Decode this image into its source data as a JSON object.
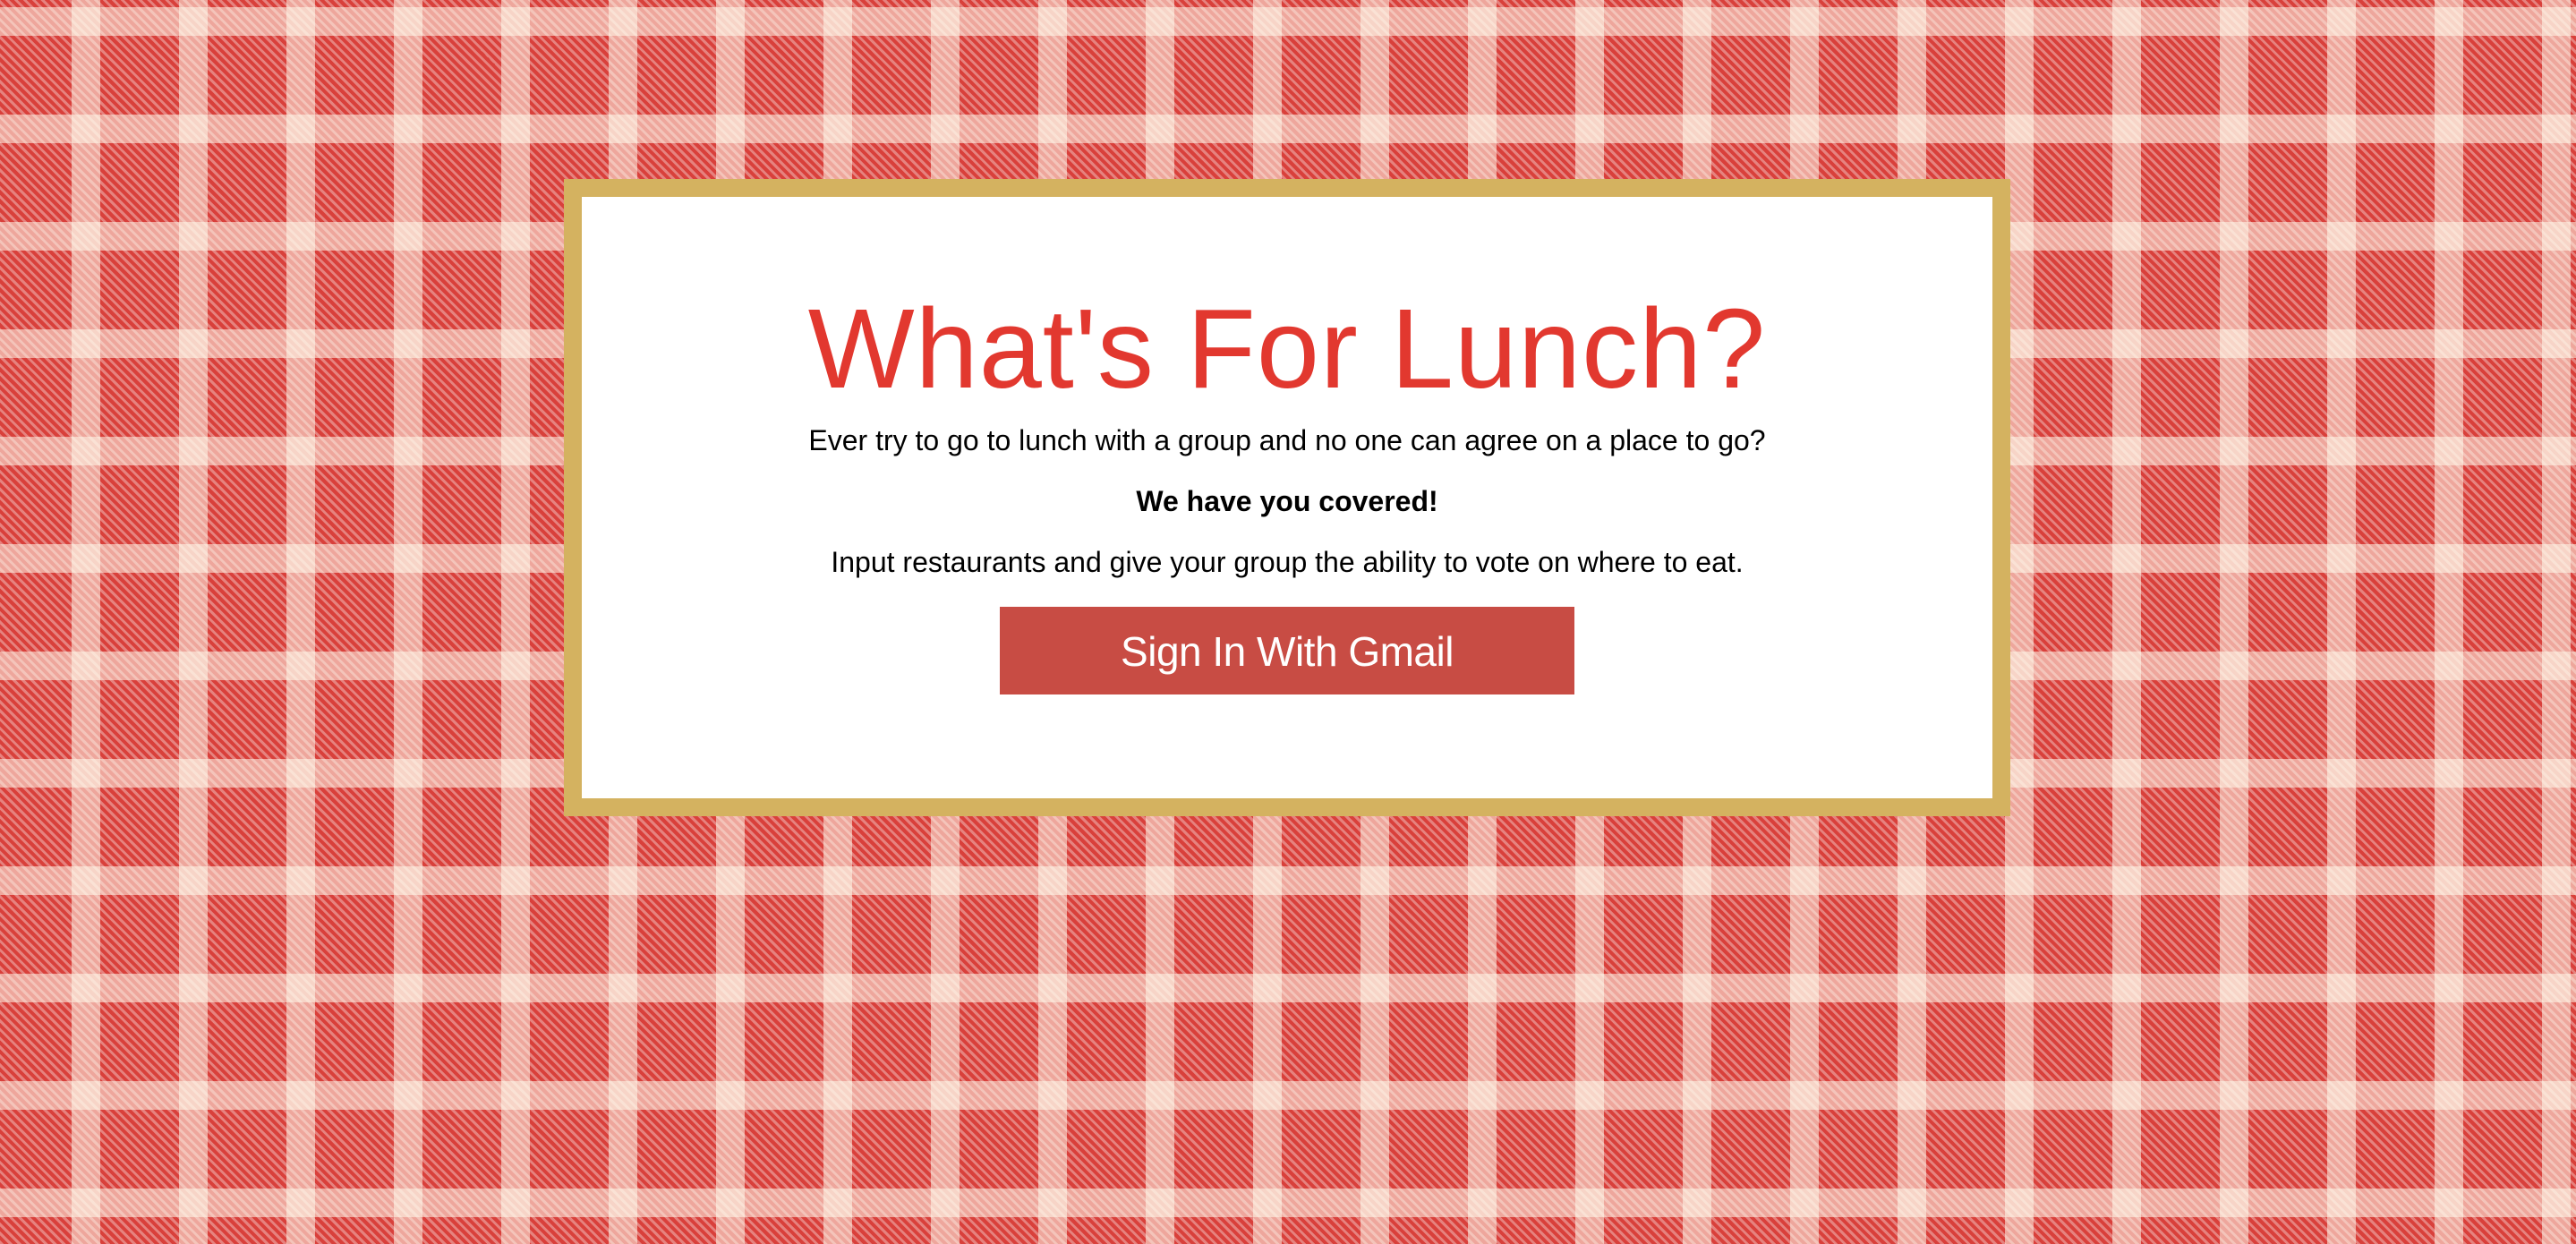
{
  "page": {
    "background_colors": {
      "red": "#d9403b",
      "cream": "#fffaeb"
    }
  },
  "card": {
    "frame_color": "#d4b260",
    "title": "What's For Lunch?",
    "title_color": "#e2382f",
    "intro": "Ever try to go to lunch with a group and no one can agree on a place to go?",
    "tagline": "We have you covered!",
    "description": "Input restaurants and give your group the ability to vote on where to eat.",
    "signin_label": "Sign In With Gmail",
    "signin_color": "#c84c44"
  }
}
